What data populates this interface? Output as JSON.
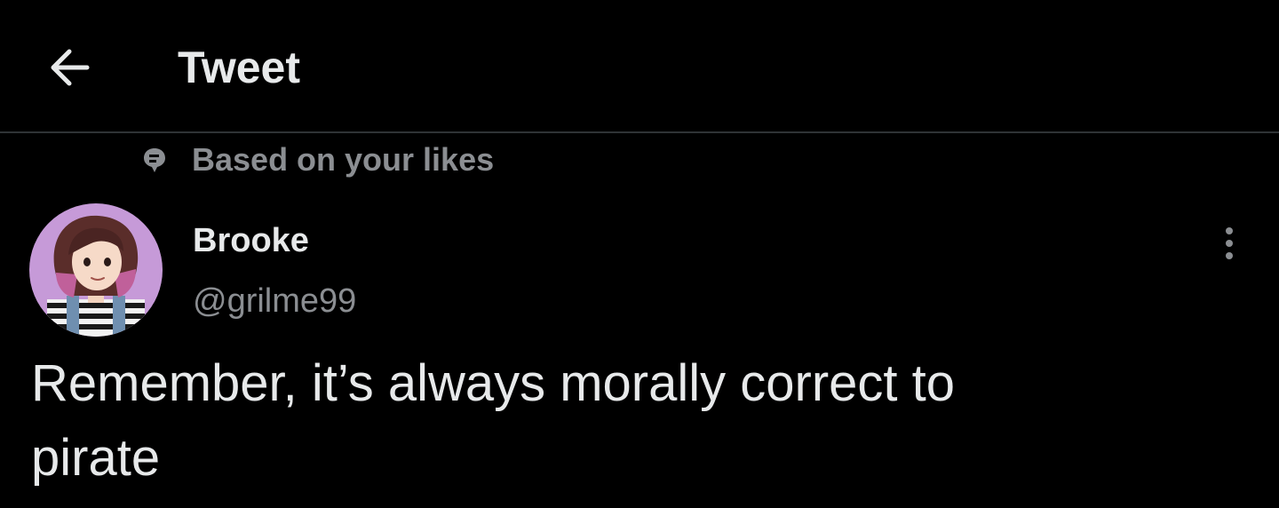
{
  "header": {
    "back_icon": "arrow-left-icon",
    "title": "Tweet"
  },
  "social_context": {
    "icon": "spark-bubble-icon",
    "text": "Based on your likes"
  },
  "tweet": {
    "author": {
      "display_name": "Brooke",
      "handle": "@grilme99",
      "avatar_bg": "#c69ad8"
    },
    "more_icon": "more-vertical-icon",
    "text": "Remember, it’s always morally correct to\npirate"
  },
  "colors": {
    "background": "#000000",
    "primary_text": "#e7e9ea",
    "secondary_text": "#8b8e92",
    "divider": "#2f3336"
  }
}
